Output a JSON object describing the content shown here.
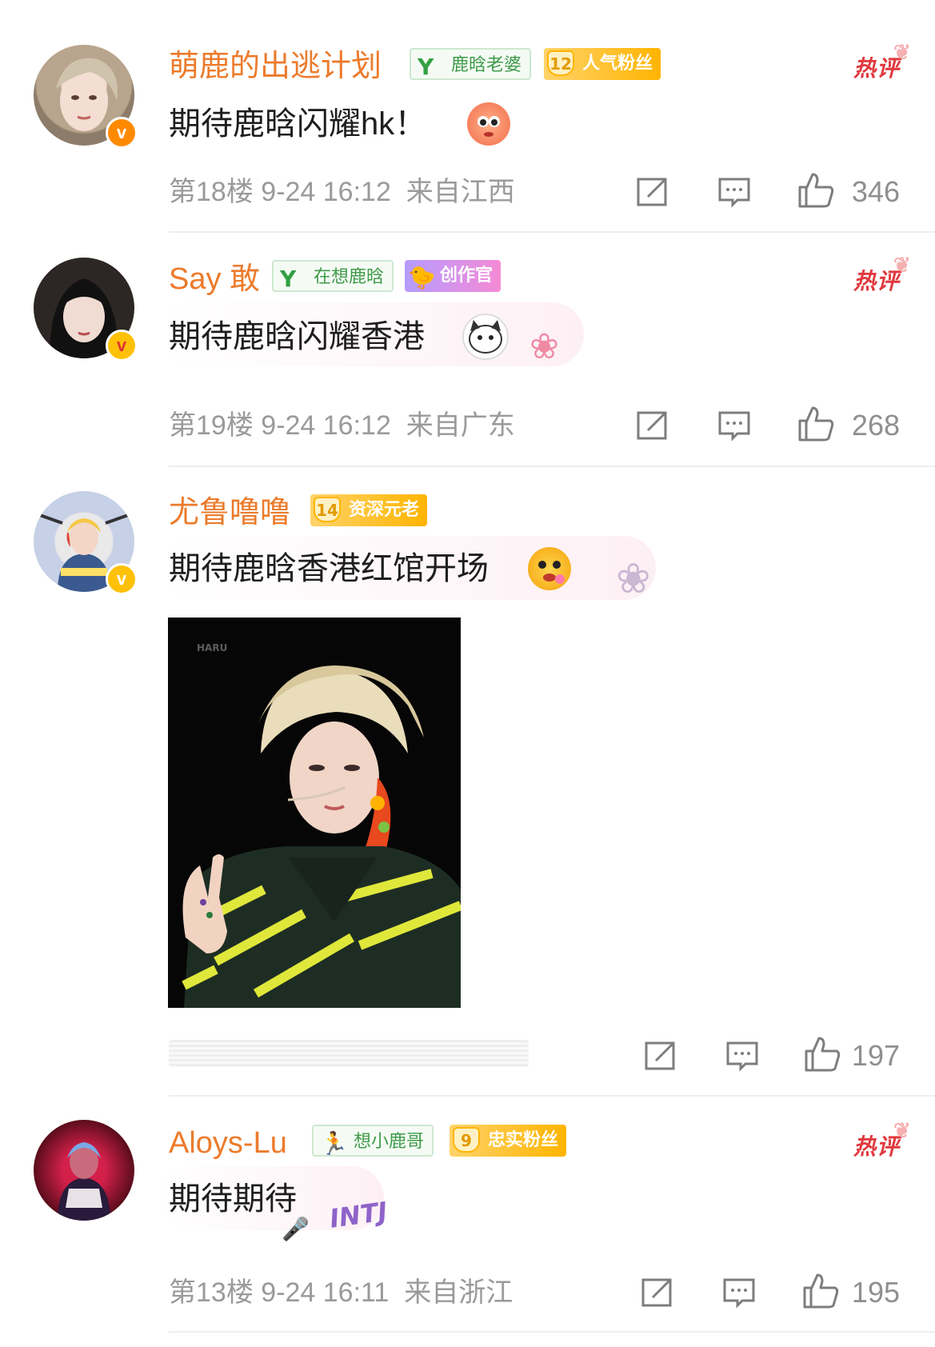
{
  "comments": [
    {
      "username": "萌鹿的出逃计划",
      "badge_green": "鹿晗老婆",
      "badge_gold_level": "12",
      "badge_gold": "人气粉丝",
      "hot_label": "热评",
      "text": "期待鹿晗闪耀hk！",
      "emoji": "sticker-icon",
      "floor": "第18楼",
      "date": "9-24 16:12",
      "location": "来自江西",
      "likes": "346"
    },
    {
      "username": "Say 敢",
      "badge_green": "在想鹿晗",
      "badge_purple": "创作官",
      "hot_label": "热评",
      "text": "期待鹿晗闪耀香港",
      "emoji": "cat-sticker-icon",
      "floor": "第19楼",
      "date": "9-24 16:12",
      "location": "来自广东",
      "likes": "268"
    },
    {
      "username": "尤鲁噜噜",
      "badge_gold_level": "14",
      "badge_gold": "资深元老",
      "text": "期待鹿晗香港红馆开场",
      "emoji": "flower-face-sticker-icon",
      "photo": "performer-photo",
      "photo_watermark": "HARU",
      "likes": "197"
    },
    {
      "username": "Aloys-Lu",
      "badge_green": "想小鹿哥",
      "badge_gold_level": "9",
      "badge_gold": "忠实粉丝",
      "hot_label": "热评",
      "text": "期待期待",
      "deco_text": "INTJ",
      "floor": "第13楼",
      "date": "9-24 16:11",
      "location": "来自浙江",
      "likes": "195"
    }
  ],
  "colors": {
    "username": "#ec7b2c",
    "hot": "#e0393e",
    "meta": "#9a9a9a",
    "badge_green": "#3f9a4a",
    "badge_gold": "#ffb400"
  }
}
